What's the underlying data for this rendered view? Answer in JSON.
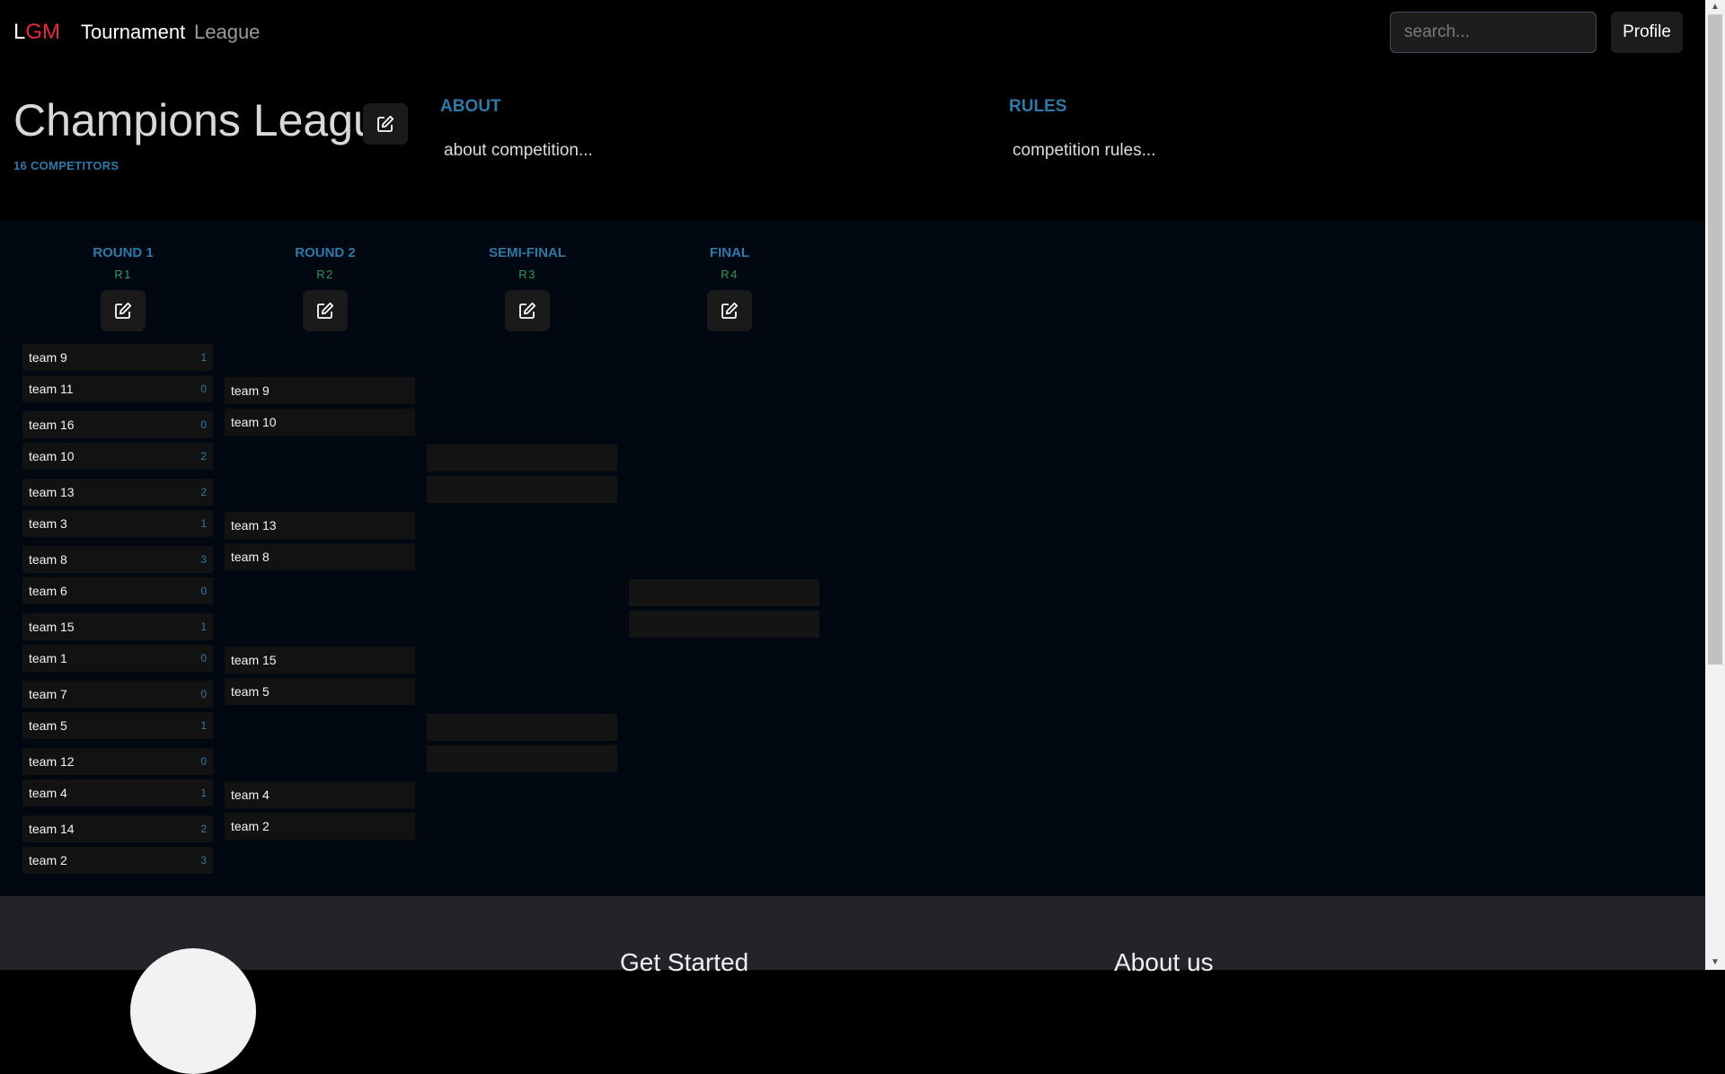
{
  "nav": {
    "brand_l": "L",
    "brand_gm": "GM",
    "links": [
      "Tournament",
      "League"
    ],
    "search_placeholder": "search...",
    "profile_label": "Profile"
  },
  "header": {
    "title": "Champions League",
    "competitors": "16 COMPETITORS",
    "about_heading": "ABOUT",
    "about_text": "about competition...",
    "rules_heading": "RULES",
    "rules_text": "competition rules..."
  },
  "rounds": [
    {
      "name": "ROUND 1",
      "code": "R1"
    },
    {
      "name": "ROUND 2",
      "code": "R2"
    },
    {
      "name": "SEMI-FINAL",
      "code": "R3"
    },
    {
      "name": "FINAL",
      "code": "R4"
    }
  ],
  "round1": [
    [
      {
        "team": "team 9",
        "score": "1"
      },
      {
        "team": "team 11",
        "score": "0"
      }
    ],
    [
      {
        "team": "team 16",
        "score": "0"
      },
      {
        "team": "team 10",
        "score": "2"
      }
    ],
    [
      {
        "team": "team 13",
        "score": "2"
      },
      {
        "team": "team 3",
        "score": "1"
      }
    ],
    [
      {
        "team": "team 8",
        "score": "3"
      },
      {
        "team": "team 6",
        "score": "0"
      }
    ],
    [
      {
        "team": "team 15",
        "score": "1"
      },
      {
        "team": "team 1",
        "score": "0"
      }
    ],
    [
      {
        "team": "team 7",
        "score": "0"
      },
      {
        "team": "team 5",
        "score": "1"
      }
    ],
    [
      {
        "team": "team 12",
        "score": "0"
      },
      {
        "team": "team 4",
        "score": "1"
      }
    ],
    [
      {
        "team": "team 14",
        "score": "2"
      },
      {
        "team": "team 2",
        "score": "3"
      }
    ]
  ],
  "round2": [
    [
      {
        "team": "team 9",
        "score": ""
      },
      {
        "team": "team 10",
        "score": ""
      }
    ],
    [
      {
        "team": "team 13",
        "score": ""
      },
      {
        "team": "team 8",
        "score": ""
      }
    ],
    [
      {
        "team": "team 15",
        "score": ""
      },
      {
        "team": "team 5",
        "score": ""
      }
    ],
    [
      {
        "team": "team 4",
        "score": ""
      },
      {
        "team": "team 2",
        "score": ""
      }
    ]
  ],
  "round3": [
    [
      {
        "team": "",
        "score": ""
      },
      {
        "team": "",
        "score": ""
      }
    ],
    [
      {
        "team": "",
        "score": ""
      },
      {
        "team": "",
        "score": ""
      }
    ]
  ],
  "round4": [
    [
      {
        "team": "",
        "score": ""
      },
      {
        "team": "",
        "score": ""
      }
    ]
  ],
  "footer": {
    "get_started": "Get Started",
    "about_us": "About us"
  },
  "icons": {
    "edit": "edit-icon"
  },
  "colors": {
    "brand_red": "#e8283c",
    "accent_blue": "#2f79a8",
    "accent_green": "#2e9a5a"
  }
}
